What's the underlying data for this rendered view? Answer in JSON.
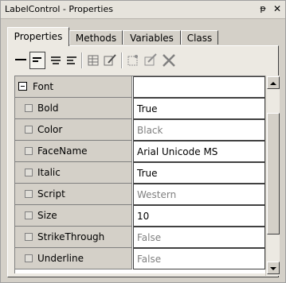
{
  "window": {
    "title": "LabelControl - Properties",
    "pin_glyph": "ᵽ",
    "close_glyph": "✕"
  },
  "tabs": [
    {
      "label": "Properties",
      "active": true
    },
    {
      "label": "Methods",
      "active": false
    },
    {
      "label": "Variables",
      "active": false
    },
    {
      "label": "Class",
      "active": false
    }
  ],
  "toolbar": {
    "buttons": [
      {
        "icon": "line-icon"
      },
      {
        "icon": "align-left-icon",
        "pressed": true
      },
      {
        "icon": "align-center-icon"
      },
      {
        "icon": "align-right-icon"
      },
      {
        "icon": "properties-grid-icon"
      },
      {
        "icon": "properties-edit-icon"
      },
      {
        "icon": "new-item-icon"
      },
      {
        "icon": "edit-item-icon"
      },
      {
        "icon": "delete-icon"
      }
    ]
  },
  "properties": {
    "group": {
      "name": "Font",
      "value": ""
    },
    "rows": [
      {
        "name": "Bold",
        "value": "True",
        "muted": false
      },
      {
        "name": "Color",
        "value": "Black",
        "muted": true
      },
      {
        "name": "FaceName",
        "value": "Arial Unicode MS",
        "muted": false
      },
      {
        "name": "Italic",
        "value": "True",
        "muted": false
      },
      {
        "name": "Script",
        "value": "Western",
        "muted": true
      },
      {
        "name": "Size",
        "value": "10",
        "muted": false
      },
      {
        "name": "StrikeThrough",
        "value": "False",
        "muted": true
      },
      {
        "name": "Underline",
        "value": "False",
        "muted": true
      }
    ]
  },
  "colors": {
    "panel_bg": "#ece9e2",
    "chrome": "#d4d0c8",
    "muted_text": "#808080"
  }
}
